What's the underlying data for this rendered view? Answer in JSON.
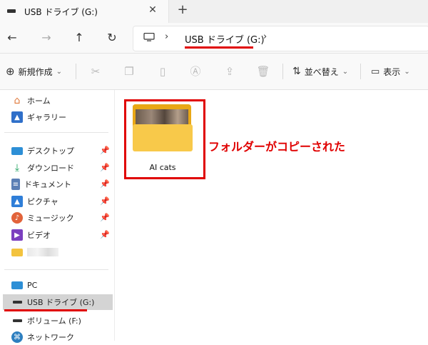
{
  "tab": {
    "title": "USB ドライブ (G:)",
    "close": "✕",
    "add": "+"
  },
  "nav": {
    "back": "←",
    "forward": "→",
    "up": "↑",
    "refresh": "↻"
  },
  "address": {
    "separator": "›",
    "crumb": "USB ドライブ (G:)"
  },
  "toolbar": {
    "new_label": "新規作成",
    "sort_label": "並べ替え",
    "view_label": "表示",
    "chevron": "⌄"
  },
  "sidebar": {
    "home": "ホーム",
    "gallery": "ギャラリー",
    "desktop": "デスクトップ",
    "downloads": "ダウンロード",
    "documents": "ドキュメント",
    "pictures": "ピクチャ",
    "music": "ミュージック",
    "videos": "ビデオ",
    "pc": "PC",
    "usb": "USB ドライブ (G:)",
    "volume": "ボリューム (F:)",
    "network": "ネットワーク"
  },
  "content": {
    "folder_name": "AI cats",
    "annotation": "フォルダーがコピーされた"
  },
  "colors": {
    "accent_red": "#e00000",
    "folder": "#f8c94a"
  }
}
